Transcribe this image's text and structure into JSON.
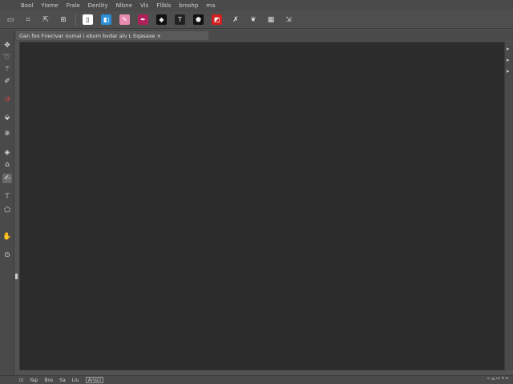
{
  "menu": [
    "Bool",
    "Yiome",
    "Frale",
    "Denlity",
    "Nlbne",
    "Vls",
    "Fllbls",
    "broshp",
    "ma"
  ],
  "options_bar": {
    "icons": [
      {
        "name": "selection-icon",
        "glyph": "▭"
      },
      {
        "name": "crop-icon",
        "glyph": "⌗"
      },
      {
        "name": "transform-icon",
        "glyph": "⇱"
      },
      {
        "name": "frame-icon",
        "glyph": "⊞"
      },
      {
        "name": "document-icon",
        "glyph": "▯"
      },
      {
        "name": "brush-icon",
        "glyph": "◧"
      },
      {
        "name": "eraser-icon",
        "glyph": "✎"
      },
      {
        "name": "pen-icon",
        "glyph": "✒"
      },
      {
        "name": "stamp-icon",
        "glyph": "◆"
      },
      {
        "name": "type-icon",
        "glyph": "T"
      },
      {
        "name": "shape-icon",
        "glyph": "⬟"
      },
      {
        "name": "fill-icon",
        "glyph": "◩"
      },
      {
        "name": "quill-icon",
        "glyph": "✗"
      },
      {
        "name": "smudge-icon",
        "glyph": "❦"
      },
      {
        "name": "grid-icon",
        "glyph": "▦"
      },
      {
        "name": "export-icon",
        "glyph": "⇲"
      }
    ],
    "colors": {
      "blue": "#2a8fd6",
      "pink": "#e88ab0",
      "magenta": "#b0205a",
      "red": "#d42020",
      "white": "#ffffff",
      "black": "#111111"
    }
  },
  "document_tab": {
    "title": "Gan foo Fnecivar oumai i xbum bvdar alv L Eqasaxe ×"
  },
  "toolbar": {
    "tools": [
      {
        "name": "move-tool-icon",
        "glyph": "✥"
      },
      {
        "name": "lasso-tool-icon",
        "glyph": "➰"
      },
      {
        "name": "magic-wand-tool-icon",
        "glyph": "⚚"
      },
      {
        "name": "brush-tool-icon",
        "glyph": "✐"
      },
      {
        "name": "spot-heal-tool-icon",
        "glyph": "↺"
      },
      {
        "name": "eraser-tool-icon",
        "glyph": "⬙"
      },
      {
        "name": "clone-tool-icon",
        "glyph": "⎈"
      },
      {
        "name": "blur-tool-icon",
        "glyph": "◈"
      },
      {
        "name": "gradient-tool-icon",
        "glyph": "⌂"
      },
      {
        "name": "path-tool-icon",
        "glyph": "✍"
      },
      {
        "name": "type-tool-icon",
        "glyph": "⊤"
      },
      {
        "name": "shape-tool-icon",
        "glyph": "⬠"
      },
      {
        "name": "hand-tool-icon",
        "glyph": "✋"
      },
      {
        "name": "zoom-tool-icon",
        "glyph": "⊙"
      }
    ]
  },
  "status": {
    "items": [
      "⊡",
      "Yap",
      "Bos",
      "Sa",
      "Liu"
    ],
    "field": "ArisLl",
    "right": "ᵐ ᵐ̶ ʰᴷ ᴴ̃ ᴹ"
  }
}
